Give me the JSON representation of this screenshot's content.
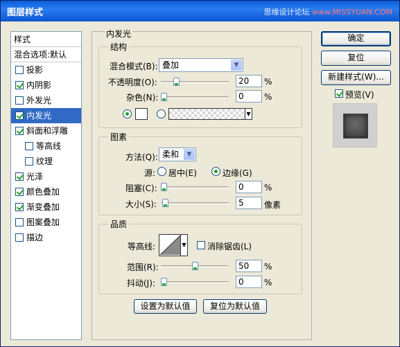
{
  "window": {
    "title": "图层样式",
    "brand_text": "思缘设计论坛",
    "brand_url": "www.MISSYUAN.COM"
  },
  "style_list": {
    "header": "样式",
    "blend": "混合选项:默认",
    "items": [
      {
        "label": "投影",
        "checked": false,
        "indent": false,
        "selected": false
      },
      {
        "label": "内阴影",
        "checked": true,
        "indent": false,
        "selected": false
      },
      {
        "label": "外发光",
        "checked": false,
        "indent": false,
        "selected": false
      },
      {
        "label": "内发光",
        "checked": true,
        "indent": false,
        "selected": true
      },
      {
        "label": "斜面和浮雕",
        "checked": true,
        "indent": false,
        "selected": false
      },
      {
        "label": "等高线",
        "checked": false,
        "indent": true,
        "selected": false
      },
      {
        "label": "纹理",
        "checked": false,
        "indent": true,
        "selected": false
      },
      {
        "label": "光泽",
        "checked": true,
        "indent": false,
        "selected": false
      },
      {
        "label": "颜色叠加",
        "checked": true,
        "indent": false,
        "selected": false
      },
      {
        "label": "渐变叠加",
        "checked": true,
        "indent": false,
        "selected": false
      },
      {
        "label": "图案叠加",
        "checked": false,
        "indent": false,
        "selected": false
      },
      {
        "label": "描边",
        "checked": false,
        "indent": false,
        "selected": false
      }
    ]
  },
  "panel": {
    "title": "内发光",
    "structure": {
      "label": "结构",
      "blend_mode_label": "混合模式(B):",
      "blend_mode_value": "叠加",
      "opacity_label": "不透明度(O):",
      "opacity_value": "20",
      "opacity_unit": "%",
      "opacity_fraction": 0.2,
      "noise_label": "杂色(N):",
      "noise_value": "0",
      "noise_unit": "%",
      "noise_fraction": 0.0,
      "color_selected": "solid"
    },
    "elements": {
      "label": "图素",
      "technique_label": "方法(Q):",
      "technique_value": "柔和",
      "source_label": "源:",
      "source_center": "居中(E)",
      "source_edge": "边缘(G)",
      "source_selected": "edge",
      "choke_label": "阻塞(C):",
      "choke_value": "0",
      "choke_unit": "%",
      "choke_fraction": 0.0,
      "size_label": "大小(S):",
      "size_value": "5",
      "size_unit": "像素",
      "size_fraction": 0.02
    },
    "quality": {
      "label": "品质",
      "contour_label": "等高线:",
      "antialias_label": "消除锯齿(L)",
      "antialias_checked": false,
      "range_label": "范围(R):",
      "range_value": "50",
      "range_unit": "%",
      "range_fraction": 0.5,
      "jitter_label": "抖动(J):",
      "jitter_value": "0",
      "jitter_unit": "%",
      "jitter_fraction": 0.0
    },
    "set_default_button": "设置为默认值",
    "reset_default_button": "复位为默认值"
  },
  "right": {
    "ok_button": "确定",
    "reset_button": "复位",
    "new_style_button": "新建样式(W)...",
    "preview_label": "预览(V)",
    "preview_checked": true
  },
  "colors": {
    "titlebar": "#0a5fd8",
    "selection": "#316ac5",
    "face": "#ece9d8"
  }
}
